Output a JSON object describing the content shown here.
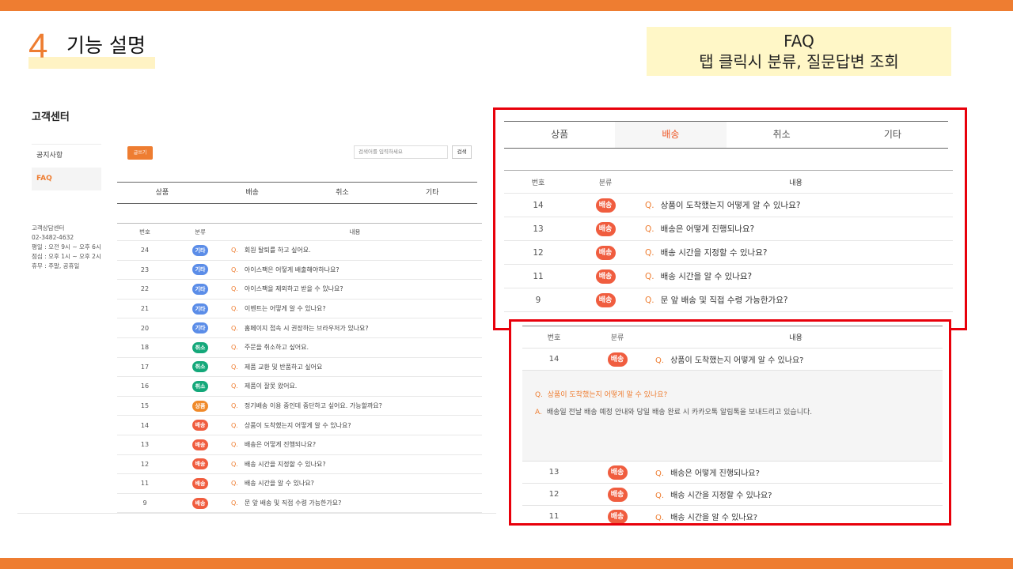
{
  "slide": {
    "number": "4",
    "title": "기능 설명",
    "note_line1": "FAQ",
    "note_line2": "탭 클릭시 분류, 질문답변 조회"
  },
  "colors": {
    "accent": "#ee7d31",
    "etc": "#5b8de8",
    "cancel": "#14a87a",
    "product": "#f08a2a",
    "delivery": "#f05d3f",
    "highlight_border": "#e8000b"
  },
  "left": {
    "title": "고객센터",
    "menu": [
      "공지사항",
      "FAQ"
    ],
    "contact": [
      "고객상담센터",
      "02-3482-4632",
      "평일 : 오전 9시 ~ 오후 6시",
      "점심 : 오후 1시 ~ 오후 2시",
      "휴무 : 주말, 공휴일"
    ],
    "write_button": "글쓰기",
    "search_placeholder": "검색어를 입력하세요",
    "search_button": "검색",
    "tabs": [
      "상품",
      "배송",
      "취소",
      "기타"
    ],
    "headers": [
      "번호",
      "분류",
      "내용"
    ],
    "rows": [
      {
        "no": "24",
        "cat": "기타",
        "color": "#5b8de8",
        "q": "회원 탈퇴를 하고 싶어요."
      },
      {
        "no": "23",
        "cat": "기타",
        "color": "#5b8de8",
        "q": "아이스팩은 어떻게 배출해야하나요?"
      },
      {
        "no": "22",
        "cat": "기타",
        "color": "#5b8de8",
        "q": "아이스팩을 제외하고 받을 수 있나요?"
      },
      {
        "no": "21",
        "cat": "기타",
        "color": "#5b8de8",
        "q": "이벤트는 어떻게 알 수 있나요?"
      },
      {
        "no": "20",
        "cat": "기타",
        "color": "#5b8de8",
        "q": "홈페이지 접속 시 권장하는 브라우저가 있나요?"
      },
      {
        "no": "18",
        "cat": "취소",
        "color": "#14a87a",
        "q": "주문을 취소하고 싶어요."
      },
      {
        "no": "17",
        "cat": "취소",
        "color": "#14a87a",
        "q": "제품 교환 및 반품하고 싶어요"
      },
      {
        "no": "16",
        "cat": "취소",
        "color": "#14a87a",
        "q": "제품이 잘못 왔어요."
      },
      {
        "no": "15",
        "cat": "상품",
        "color": "#f08a2a",
        "q": "정기배송 이용 중인데 중단하고 싶어요. 가능할까요?"
      },
      {
        "no": "14",
        "cat": "배송",
        "color": "#f05d3f",
        "q": "상품이 도착했는지 어떻게 알 수 있나요?"
      },
      {
        "no": "13",
        "cat": "배송",
        "color": "#f05d3f",
        "q": "배송은 어떻게 진행되나요?"
      },
      {
        "no": "12",
        "cat": "배송",
        "color": "#f05d3f",
        "q": "배송 시간을 지정할 수 있나요?"
      },
      {
        "no": "11",
        "cat": "배송",
        "color": "#f05d3f",
        "q": "배송 시간을 알 수 있나요?"
      },
      {
        "no": "9",
        "cat": "배송",
        "color": "#f05d3f",
        "q": "문 앞 배송 및 직접 수령 가능한가요?"
      }
    ]
  },
  "right_top": {
    "tabs": [
      "상품",
      "배송",
      "취소",
      "기타"
    ],
    "active_tab": "배송",
    "headers": [
      "번호",
      "분류",
      "내용"
    ],
    "rows": [
      {
        "no": "14",
        "cat": "배송",
        "q": "상품이 도착했는지 어떻게 알 수 있나요?"
      },
      {
        "no": "13",
        "cat": "배송",
        "q": "배송은 어떻게 진행되나요?"
      },
      {
        "no": "12",
        "cat": "배송",
        "q": "배송 시간을 지정할 수 있나요?"
      },
      {
        "no": "11",
        "cat": "배송",
        "q": "배송 시간을 알 수 있나요?"
      },
      {
        "no": "9",
        "cat": "배송",
        "q": "문 앞 배송 및 직접 수령 가능한가요?"
      }
    ]
  },
  "right_bottom": {
    "headers": [
      "번호",
      "분류",
      "내용"
    ],
    "expanded": {
      "no": "14",
      "cat": "배송",
      "q": "상품이 도착했는지 어떻게 알 수 있나요?"
    },
    "answer_q": "상품이 도착했는지 어떻게 알 수 있나요?",
    "answer_a": "배송일 전날 배송 예정 안내와 당일 배송 완료 시 카카오톡 알림톡을 보내드리고 있습니다.",
    "q_mark": "Q.",
    "a_mark": "A.",
    "rows": [
      {
        "no": "13",
        "cat": "배송",
        "q": "배송은 어떻게 진행되나요?"
      },
      {
        "no": "12",
        "cat": "배송",
        "q": "배송 시간을 지정할 수 있나요?"
      },
      {
        "no": "11",
        "cat": "배송",
        "q": "배송 시간을 알 수 있나요?"
      }
    ]
  }
}
